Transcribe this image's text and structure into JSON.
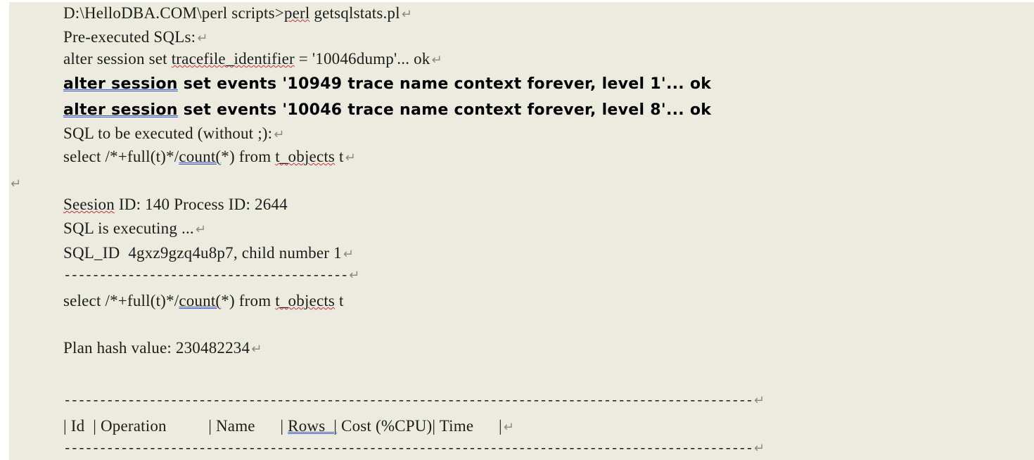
{
  "paragraph_mark": "↵",
  "lines": {
    "l1": {
      "pre": "D:\\HelloDBA.COM\\perl scripts>",
      "w1": "perl",
      "post": " getsqlstats.pl"
    },
    "l2": {
      "text": "Pre-executed SQLs:"
    },
    "l3": {
      "pre": "alter session set ",
      "w1": "tracefile_identifier",
      "post": " = '10046dump'... ok"
    },
    "l4": {
      "w1": "alter session",
      "post": " set events '10949 trace name context forever, level 1'... ok"
    },
    "l5": {
      "w1": "alter session",
      "post": " set events '10046 trace name context forever, level 8'... ok"
    },
    "l6": {
      "text": "SQL to be executed (without ;):"
    },
    "l7": {
      "pre": "select /*+full(t)*/",
      "w1": "count(",
      "mid": "*) from ",
      "w2": "t_objects",
      "post": " t"
    },
    "l8": {
      "w1": "Seesion",
      "post": " ID: 140 Process ID: 2644"
    },
    "l9": {
      "text": "SQL is executing ..."
    },
    "l10": {
      "text": "SQL_ID  4gxz9gzq4u8p7, child number 1"
    },
    "l11": {
      "text": "----------------------------------------"
    },
    "l12": {
      "pre": "select /*+full(t)*/",
      "w1": "count(",
      "mid": "*) from ",
      "w2": "t_objects",
      "post": " t"
    },
    "l13": {
      "text": "Plan hash value: 230482234"
    },
    "l14": {
      "text": "-------------------------------------------------------------------------------------------------"
    },
    "l15": {
      "pre": "| Id  | Operation          | Name      | ",
      "w1": "Rows  |",
      "post": " Cost (%CPU)| Time      |"
    },
    "l16": {
      "text": "-------------------------------------------------------------------------------------------------"
    }
  }
}
